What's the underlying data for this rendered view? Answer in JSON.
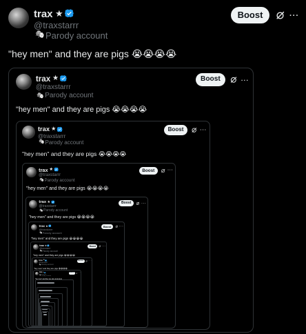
{
  "post": {
    "name": "trax",
    "name_suffix": "★",
    "handle": "@traxstarrr",
    "parody_label": "Parody account",
    "parody_icon": "mask-icon",
    "text": "\"hey men\" and they are pigs 😭😭😭😭",
    "boost_label": "Boost",
    "grok_icon": "grok-icon",
    "more_icon": "···",
    "verified_color": "#1d9bf0"
  }
}
